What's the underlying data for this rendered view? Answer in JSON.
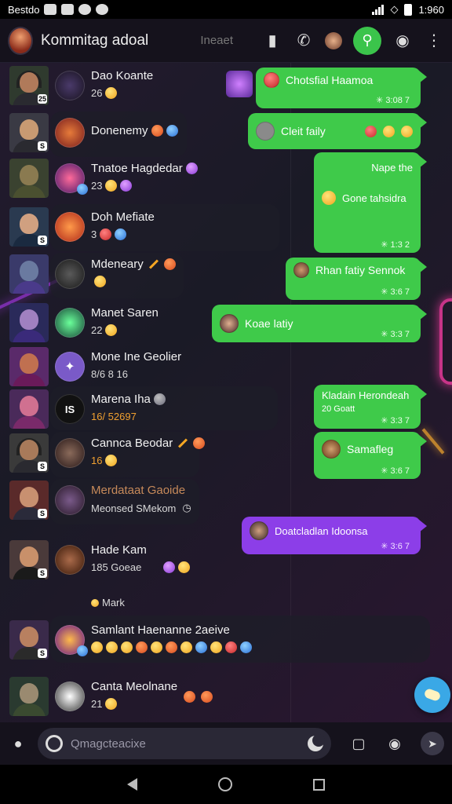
{
  "statusbar": {
    "left_text": "Bestdo",
    "time": "1:960"
  },
  "header": {
    "title": "Kommitag adoal",
    "center_label": "Ineaet"
  },
  "colors": {
    "bubble_green": "#3fca4a",
    "bubble_purple": "#8c3ee8",
    "fab_blue": "#3aa8e6",
    "app_bar": "#15121c"
  },
  "chats": [
    {
      "name": "Dao Koante",
      "sub": "26"
    },
    {
      "name": "Donenemy",
      "sub": ""
    },
    {
      "name": "Tnatoe Hagdedar",
      "sub": "23"
    },
    {
      "name": "Doh Mefiate",
      "sub": "3"
    },
    {
      "name": "Mdeneary",
      "sub": ""
    },
    {
      "name": "Manet Saren",
      "sub": "22"
    },
    {
      "name": "Mone Ine Geolier",
      "sub": "8/6 8 16"
    },
    {
      "name": "Marena Iha",
      "sub": "16/ 52697"
    },
    {
      "name": "Cannca Beodar",
      "sub": "16"
    },
    {
      "name": "Merdataat Gaoide",
      "sub": "Meonsed SMekom"
    },
    {
      "name": "Hade Kam",
      "sub": "185 Goeae"
    },
    {
      "name": "Samlant Haenanne 2aeive",
      "sub": ""
    },
    {
      "name": "Canta Meolnane",
      "sub": "21"
    }
  ],
  "gav_letter": "IS",
  "date_separator": "Mark",
  "messages": [
    {
      "text": "Chotsfial Haamoa",
      "meta": "✳ 3:08 7"
    },
    {
      "text": "Cleit faily",
      "meta": ""
    },
    {
      "text_top": "Nape the",
      "text": "Gone tahsidra",
      "meta": "✳ 1:3 2"
    },
    {
      "text": "Rhan fatiy Sennok",
      "meta": "✳ 3:6 7"
    },
    {
      "text": "Koae latiy",
      "meta": "✳ 3:3 7"
    },
    {
      "text": "Kladain Herondeah",
      "sub": "20 Goatt",
      "meta": "✳ 3:3 7"
    },
    {
      "text": "Samafleg",
      "meta": "✳ 3:6 7"
    },
    {
      "text": "Doatcladlan Idoonsa",
      "meta": "✳ 3:6 7"
    }
  ],
  "input": {
    "placeholder": "Qmagcteacixe"
  }
}
